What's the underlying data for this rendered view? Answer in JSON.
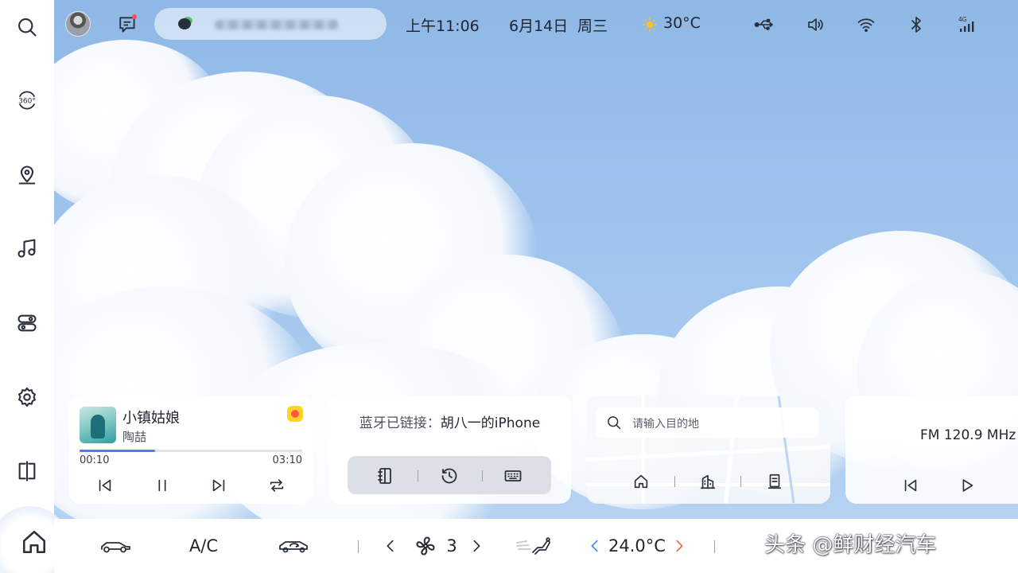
{
  "status_bar": {
    "time": "上午11:06",
    "date": "6月14日",
    "weekday": "周三",
    "weather_icon": "sun-icon",
    "temperature": "30°C",
    "icons": [
      "usb-icon",
      "volume-icon",
      "wifi-icon",
      "bluetooth-icon",
      "signal-4g-icon"
    ],
    "signal_label": "4G"
  },
  "sidebar": {
    "items": [
      {
        "name": "search-icon"
      },
      {
        "name": "360-camera-icon",
        "label": "360°"
      },
      {
        "name": "navigation-icon"
      },
      {
        "name": "music-icon"
      },
      {
        "name": "toggle-controls-icon"
      },
      {
        "name": "settings-icon"
      },
      {
        "name": "split-screen-icon"
      },
      {
        "name": "home-icon"
      }
    ]
  },
  "music": {
    "title": "小镇姑娘",
    "artist": "陶喆",
    "elapsed": "00:10",
    "duration": "03:10",
    "progress": 0.34
  },
  "bluetooth": {
    "status_label": "蓝牙已链接：",
    "device_name": "胡八一的iPhone"
  },
  "navigation": {
    "search_placeholder": "请输入目的地"
  },
  "radio": {
    "frequency": "FM 120.9 MHz"
  },
  "climate": {
    "ac_label": "A/C",
    "fan_speed": "3",
    "temperature": "24.0°C",
    "colors": {
      "decrease": "#3a8be8",
      "increase": "#e8663a"
    }
  },
  "watermark": "头条 @鲜财经汽车"
}
